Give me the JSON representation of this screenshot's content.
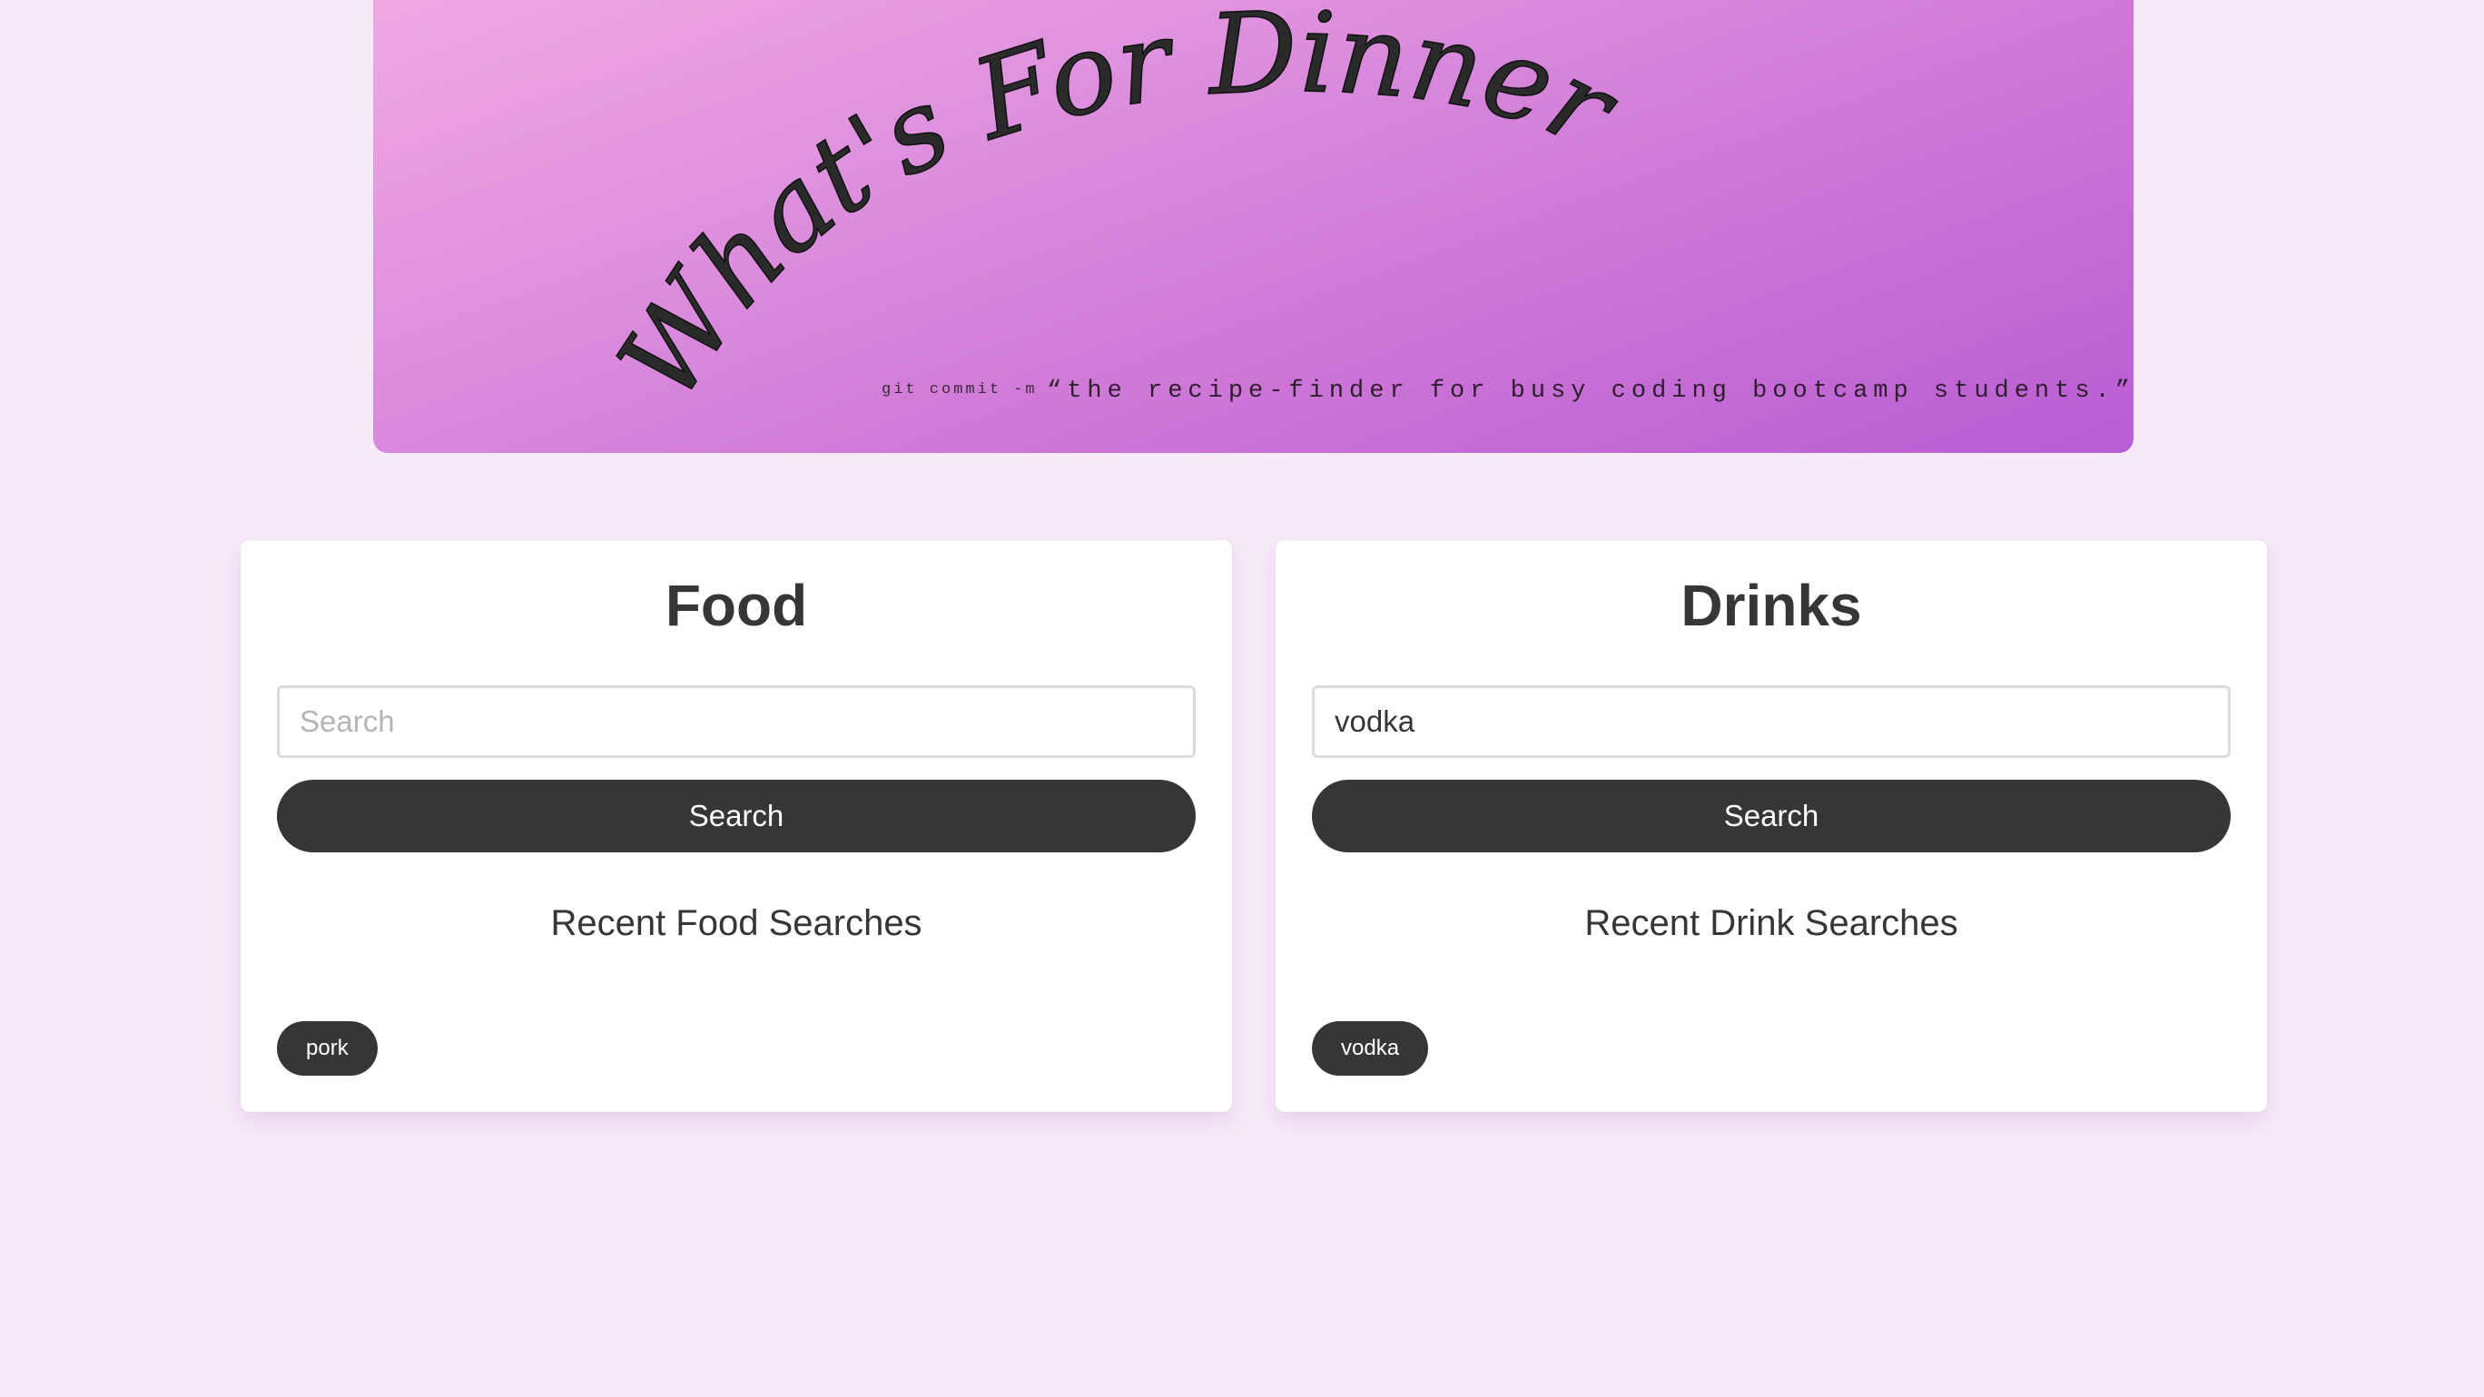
{
  "banner": {
    "title": "What's For Dinner?",
    "subtitle_prefix": "git commit -m",
    "subtitle": "“the recipe-finder for busy coding bootcamp students.”"
  },
  "food": {
    "title": "Food",
    "search_placeholder": "Search",
    "search_value": "",
    "button_label": "Search",
    "recent_heading": "Recent Food Searches",
    "recent": [
      "pork"
    ]
  },
  "drinks": {
    "title": "Drinks",
    "search_placeholder": "Search",
    "search_value": "vodka",
    "button_label": "Search",
    "recent_heading": "Recent Drink Searches",
    "recent": [
      "vodka"
    ]
  },
  "colors": {
    "background": "#f6e9f8",
    "banner_start": "#f0a8e2",
    "banner_end": "#b85dd3",
    "dark": "#363636"
  }
}
